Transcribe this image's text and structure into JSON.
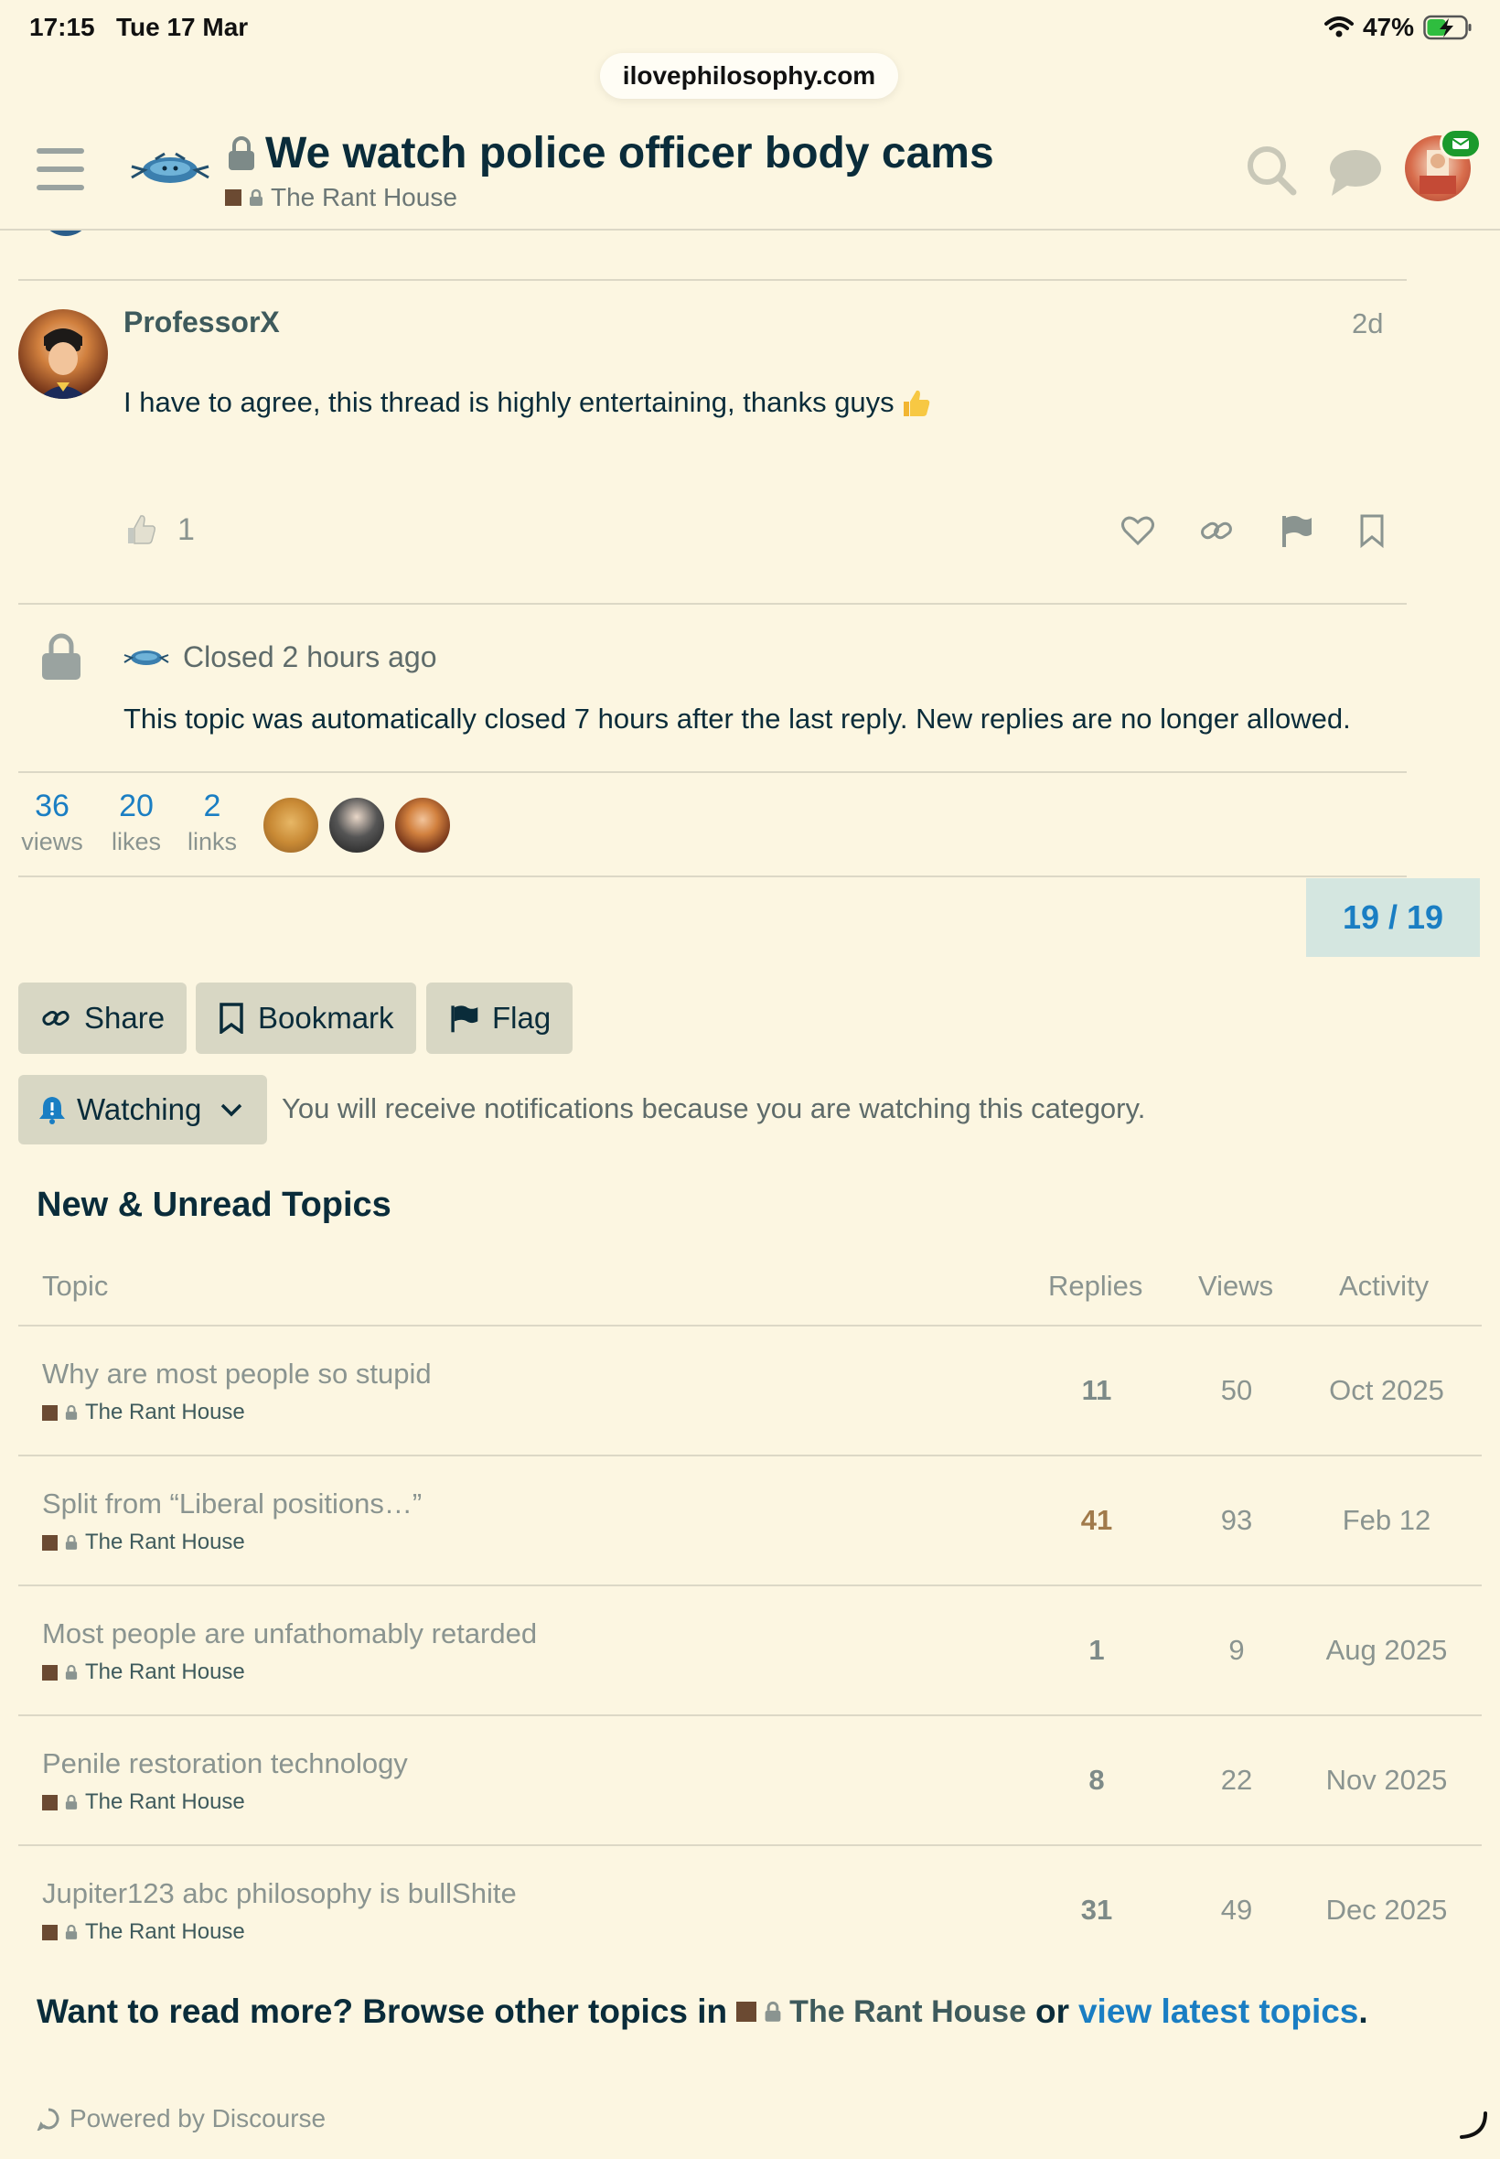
{
  "status_bar": {
    "time": "17:15",
    "date": "Tue 17 Mar",
    "battery": "47%"
  },
  "browser": {
    "url": "ilovephilosophy.com"
  },
  "header": {
    "title": "We watch police officer body cams",
    "category": "The Rant House"
  },
  "post": {
    "username": "ProfessorX",
    "time": "2d",
    "body": "I have to agree, this thread is highly entertaining, thanks guys",
    "like_count": "1"
  },
  "closed_notice": {
    "label": "Closed 2 hours ago",
    "text": "This topic was automatically closed 7 hours after the last reply. New replies are no longer allowed."
  },
  "stats": {
    "views": {
      "value": "36",
      "label": "views"
    },
    "likes": {
      "value": "20",
      "label": "likes"
    },
    "links": {
      "value": "2",
      "label": "links"
    }
  },
  "progress": "19 / 19",
  "actions": {
    "share": "Share",
    "bookmark": "Bookmark",
    "flag": "Flag"
  },
  "notifications": {
    "level": "Watching",
    "description": "You will receive notifications because you are watching this category."
  },
  "suggested": {
    "title": "New & Unread Topics",
    "columns": {
      "topic": "Topic",
      "replies": "Replies",
      "views": "Views",
      "activity": "Activity"
    },
    "rows": [
      {
        "title": "Why are most people so stupid",
        "category": "The Rant House",
        "replies": "11",
        "views": "50",
        "activity": "Oct 2025"
      },
      {
        "title": "Split from “Liberal positions…”",
        "category": "The Rant House",
        "replies": "41",
        "views": "93",
        "activity": "Feb 12"
      },
      {
        "title": "Most people are unfathomably retarded",
        "category": "The Rant House",
        "replies": "1",
        "views": "9",
        "activity": "Aug 2025"
      },
      {
        "title": "Penile restoration technology",
        "category": "The Rant House",
        "replies": "8",
        "views": "22",
        "activity": "Nov 2025"
      },
      {
        "title": "Jupiter123 abc philosophy is bullShite",
        "category": "The Rant House",
        "replies": "31",
        "views": "49",
        "activity": "Dec 2025"
      }
    ]
  },
  "footer": {
    "browse_prefix": "Want to read more? Browse other topics in",
    "browse_category": "The Rant House",
    "browse_or": "or",
    "browse_latest": "view latest topics",
    "browse_period": ".",
    "powered_by": "Powered by Discourse"
  },
  "colors": {
    "background": "#fcf6e1",
    "link_blue": "#1a7ec3",
    "category_square": "#6b4a32",
    "badge_green": "#1a9a2c"
  }
}
